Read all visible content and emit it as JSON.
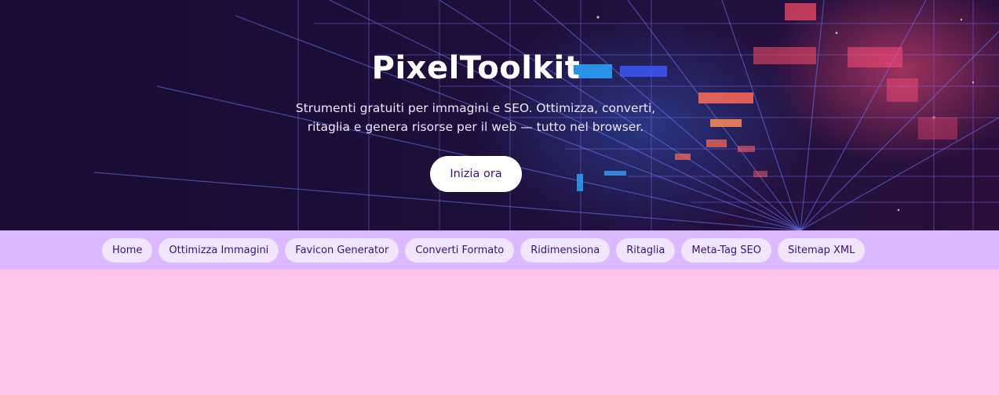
{
  "hero": {
    "title": "PixelToolkit",
    "subtitle_line1": "Strumenti gratuiti per immagini e SEO. Ottimizza, converti,",
    "subtitle_line2": "ritaglia e genera risorse per il web — tutto nel browser.",
    "cta_label": "Inizia ora"
  },
  "nav": {
    "items": [
      {
        "label": "Home"
      },
      {
        "label": "Ottimizza Immagini"
      },
      {
        "label": "Favicon Generator"
      },
      {
        "label": "Converti Formato"
      },
      {
        "label": "Ridimensiona"
      },
      {
        "label": "Ritaglia"
      },
      {
        "label": "Meta-Tag SEO"
      },
      {
        "label": "Sitemap XML"
      }
    ]
  },
  "colors": {
    "hero_background": "#1d0e3a",
    "nav_background": "#dcb8ff",
    "nav_pill": "#f1e5ff",
    "page_background": "#ffc6ea",
    "accent_text": "#3b1277"
  }
}
